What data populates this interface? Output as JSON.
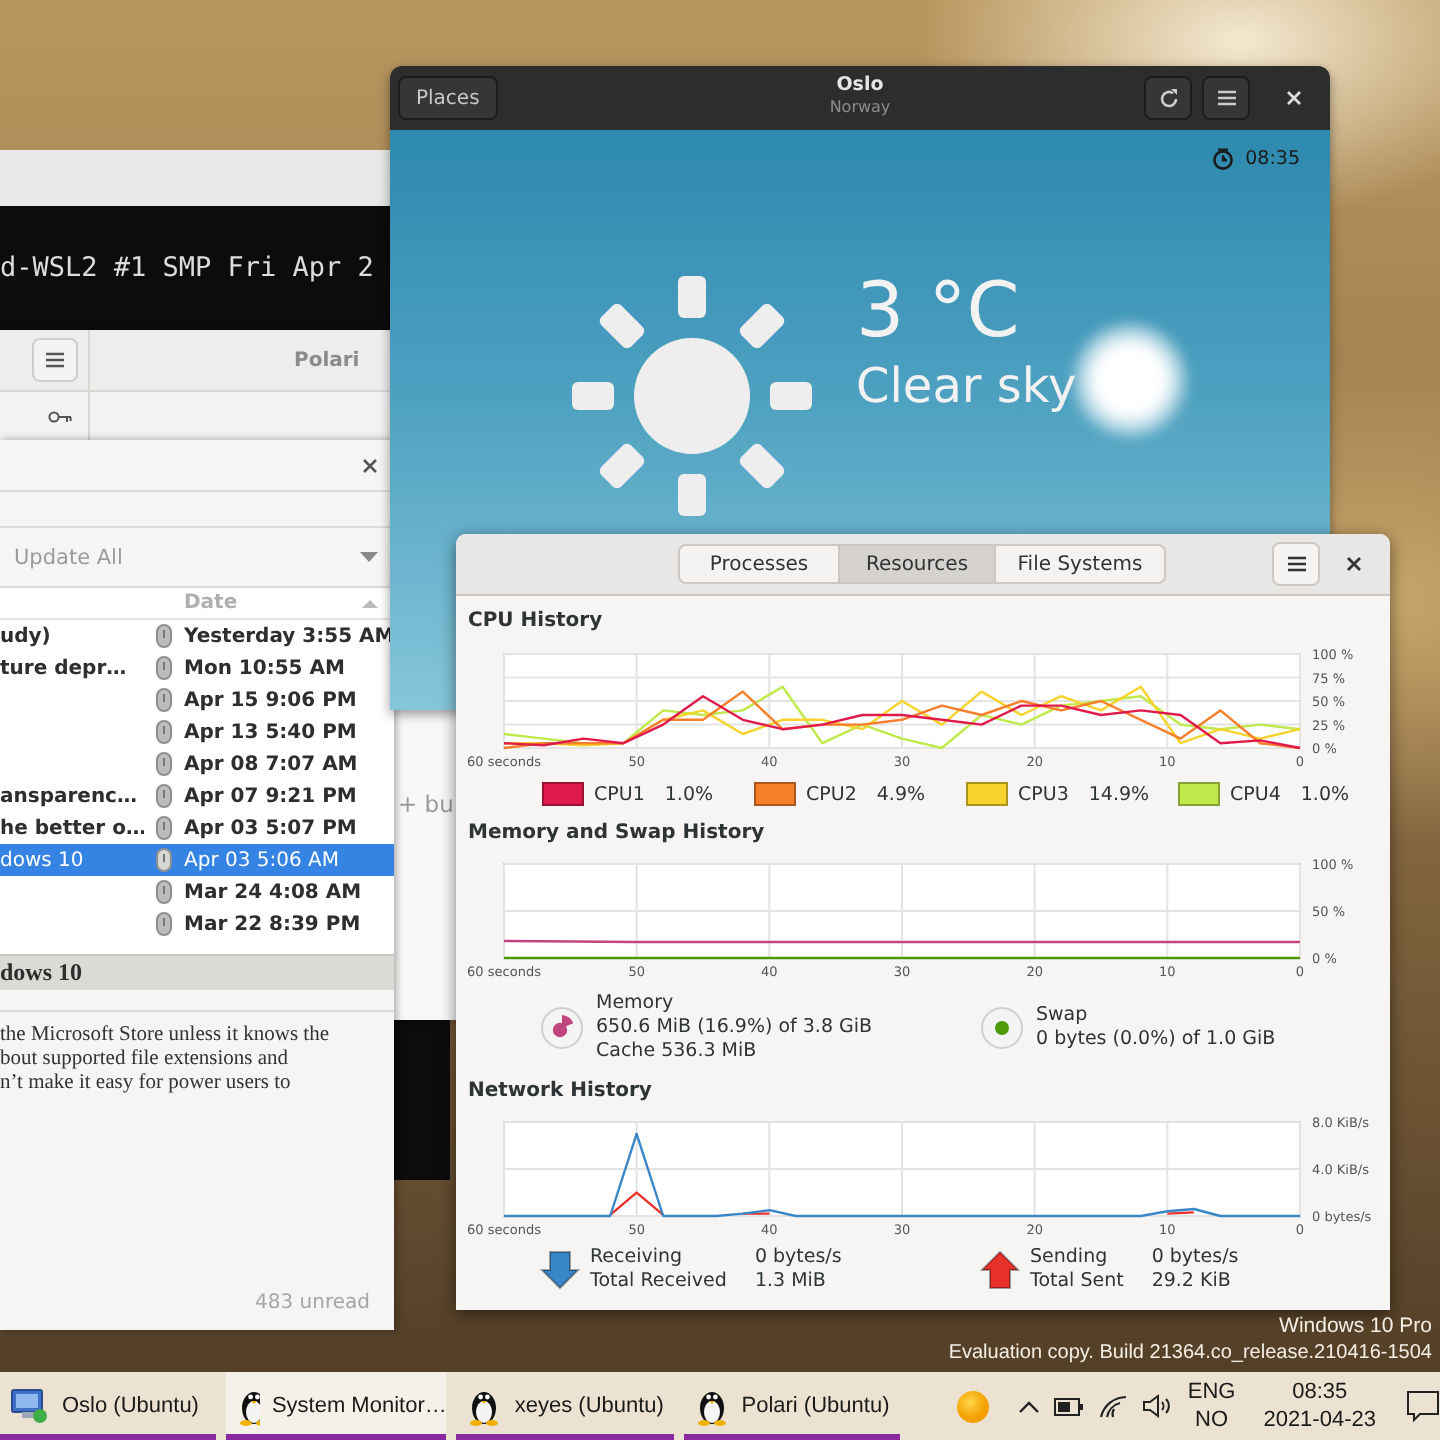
{
  "terminal": {
    "line": "d-WSL2 #1 SMP Fri Apr 2"
  },
  "polari": {
    "title": "Polari",
    "add_text": "+ bu"
  },
  "mail": {
    "update_button": "Update All",
    "date_column": "Date",
    "rows": [
      {
        "subject": "udy)",
        "date": "Yesterday 3:55 AM",
        "unread": true,
        "selected": false
      },
      {
        "subject": "ture depr…",
        "date": "Mon 10:55 AM",
        "unread": true,
        "selected": false
      },
      {
        "date": "Apr 15 9:06 PM",
        "unread": true,
        "selected": false
      },
      {
        "date": "Apr 13 5:40 PM",
        "unread": true,
        "selected": false
      },
      {
        "date": "Apr 08 7:07 AM",
        "unread": true,
        "selected": false
      },
      {
        "subject": "ansparenc…",
        "date": "Apr 07 9:21 PM",
        "unread": true,
        "selected": false
      },
      {
        "subject": "he better o…",
        "date": "Apr 03 5:07 PM",
        "unread": true,
        "selected": false
      },
      {
        "subject": "dows 10",
        "date": "Apr 03 5:06 AM",
        "unread": false,
        "selected": true
      },
      {
        "date": "Mar 24 4:08 AM",
        "unread": true,
        "selected": false
      },
      {
        "date": "Mar 22 8:39 PM",
        "unread": true,
        "selected": false
      }
    ],
    "preview_subject": "dows 10",
    "preview_lines": [
      "the Microsoft Store unless it knows the",
      "bout supported file extensions and",
      "n’t make it easy for power users to"
    ],
    "unread_count": "483 unread"
  },
  "weather": {
    "places_button": "Places",
    "title": "Oslo",
    "subtitle": "Norway",
    "time": "08:35",
    "temperature": "3 °C",
    "condition": "Clear sky"
  },
  "system_monitor": {
    "tabs": [
      {
        "label": "Processes",
        "selected": false
      },
      {
        "label": "Resources",
        "selected": true
      },
      {
        "label": "File Systems",
        "selected": false
      }
    ],
    "cpu": {
      "title": "CPU History",
      "readings": [
        "1.0%",
        "4.9%",
        "14.9%",
        "1.0%"
      ],
      "chart_data": {
        "type": "line",
        "grid": true,
        "x": [
          60,
          57,
          54,
          51,
          48,
          45,
          42,
          39,
          36,
          33,
          30,
          27,
          24,
          21,
          18,
          15,
          12,
          9,
          6,
          3,
          0
        ],
        "xlim": [
          60,
          0
        ],
        "ylim": [
          0,
          100
        ],
        "xticks": [
          {
            "value": 60,
            "label": "60 seconds"
          },
          50,
          40,
          30,
          20,
          10,
          0
        ],
        "yticks": [
          {
            "value": 0,
            "label": "0 %"
          },
          {
            "value": 25,
            "label": "25 %"
          },
          {
            "value": 50,
            "label": "50 %"
          },
          {
            "value": 75,
            "label": "75 %"
          },
          {
            "value": 100,
            "label": "100 %"
          }
        ],
        "series": [
          {
            "name": "CPU1",
            "color": "#e01b4c",
            "values": [
              5,
              3,
              10,
              5,
              25,
              55,
              30,
              20,
              25,
              35,
              35,
              30,
              25,
              45,
              45,
              35,
              40,
              35,
              5,
              8,
              0
            ]
          },
          {
            "name": "CPU2",
            "color": "#f57f2b",
            "values": [
              0,
              5,
              5,
              5,
              30,
              30,
              60,
              20,
              25,
              25,
              30,
              45,
              35,
              50,
              40,
              50,
              30,
              10,
              40,
              5,
              0
            ]
          },
          {
            "name": "CPU3",
            "color": "#f6d32d",
            "values": [
              5,
              5,
              3,
              5,
              30,
              40,
              15,
              30,
              30,
              20,
              50,
              25,
              60,
              35,
              55,
              40,
              65,
              5,
              20,
              10,
              20
            ]
          },
          {
            "name": "CPU4",
            "color": "#c0e94c",
            "values": [
              15,
              10,
              5,
              5,
              40,
              35,
              40,
              65,
              5,
              25,
              10,
              0,
              35,
              25,
              45,
              50,
              55,
              25,
              20,
              25,
              20
            ]
          }
        ]
      }
    },
    "memory": {
      "title": "Memory and Swap History",
      "memory_lines": [
        "650.6 MiB (16.9%) of 3.8 GiB",
        "Cache 536.3 MiB"
      ],
      "swap_lines": [
        "0 bytes (0.0%) of 1.0 GiB"
      ],
      "chart_data": {
        "type": "line",
        "grid": true,
        "x": [
          60,
          50,
          40,
          30,
          20,
          10,
          0
        ],
        "xlim": [
          60,
          0
        ],
        "ylim": [
          0,
          100
        ],
        "xticks": [
          {
            "value": 60,
            "label": "60 seconds"
          },
          50,
          40,
          30,
          20,
          10,
          0
        ],
        "yticks": [
          {
            "value": 0,
            "label": "0 %"
          },
          {
            "value": 50,
            "label": "50 %"
          },
          {
            "value": 100,
            "label": "100 %"
          }
        ],
        "series": [
          {
            "name": "Memory",
            "color": "#c2447f",
            "values": [
              18,
              17,
              17,
              17,
              17,
              17,
              17
            ]
          },
          {
            "name": "Swap",
            "color": "#4e9a06",
            "values": [
              0,
              0,
              0,
              0,
              0,
              0,
              0
            ]
          }
        ]
      }
    },
    "network": {
      "title": "Network History",
      "legend": [
        {
          "rate": "0 bytes/s",
          "total_label": "Total Received",
          "total": "1.3 MiB"
        },
        {
          "rate": "0 bytes/s",
          "total_label": "Total Sent",
          "total": "29.2 KiB"
        }
      ],
      "chart_data": {
        "type": "line",
        "grid": true,
        "x": [
          60,
          58,
          56,
          54,
          52,
          50,
          48,
          46,
          44,
          42,
          40,
          38,
          36,
          34,
          32,
          30,
          28,
          26,
          24,
          22,
          20,
          18,
          16,
          14,
          12,
          10,
          8,
          6,
          4,
          2,
          0
        ],
        "xlim": [
          60,
          0
        ],
        "ylim": [
          0,
          8
        ],
        "xticks": [
          {
            "value": 60,
            "label": "60 seconds"
          },
          50,
          40,
          30,
          20,
          10,
          0
        ],
        "yticks": [
          {
            "value": 0,
            "label": "0 bytes/s"
          },
          {
            "value": 4,
            "label": "4.0 KiB/s"
          },
          {
            "value": 8,
            "label": "8.0 KiB/s"
          }
        ],
        "series": [
          {
            "name": "Receiving",
            "color": "#3a87c8",
            "values": [
              0,
              0,
              0,
              0,
              0,
              7,
              0,
              0,
              0,
              0.2,
              0.5,
              0,
              0,
              0,
              0,
              0,
              0,
              0,
              0,
              0,
              0,
              0,
              0,
              0,
              0,
              0.4,
              0.6,
              0,
              0,
              0,
              0
            ]
          },
          {
            "name": "Sending",
            "color": "#e8312a",
            "values": [
              null,
              null,
              null,
              null,
              0.1,
              2,
              0.1,
              null,
              null,
              0.2,
              0.2,
              null,
              null,
              null,
              null,
              null,
              null,
              null,
              null,
              null,
              null,
              null,
              null,
              null,
              null,
              0.2,
              0.3,
              null,
              null,
              null,
              null
            ]
          }
        ]
      }
    }
  },
  "watermark": {
    "edition": "Windows 10 Pro",
    "build": "Evaluation copy. Build 21364.co_release.210416-1504"
  },
  "taskbar": {
    "items": [
      {
        "label": "Oslo (Ubuntu)",
        "kind": "remote",
        "selected": false
      },
      {
        "label": "System Monitor…",
        "kind": "penguin",
        "selected": true
      },
      {
        "label": "xeyes (Ubuntu)",
        "kind": "penguin",
        "selected": false
      },
      {
        "label": "Polari (Ubuntu)",
        "kind": "penguin",
        "selected": false
      }
    ],
    "language": "ENG",
    "region": "NO",
    "time": "08:35",
    "date": "2021-04-23"
  }
}
